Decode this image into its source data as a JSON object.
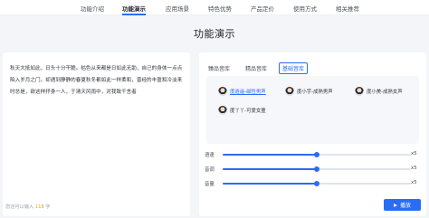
{
  "nav": {
    "items": [
      "功能介绍",
      "功能演示",
      "应用场景",
      "特色优势",
      "产品定价",
      "使用方式",
      "相关推荐"
    ],
    "active_index": 1
  },
  "section_title": "功能演示",
  "text_panel": {
    "content": "秋天大抵如此，日头十分干脆。枯色从来都是日如此无助，自己的身体一点点陷入岁月之门。却遇到静静的春夏秋冬都如此一样柔和，曾经的丰盈和冷淡来时总是，欲这样抒身一人，于清天风雨中，对我致千言者",
    "char_count_prefix": "您还可以输入",
    "char_count_value": "118",
    "char_count_suffix": "字"
  },
  "tabs": [
    "臻品音库",
    "精品音库",
    "基础音库"
  ],
  "active_tab": 2,
  "voices": [
    {
      "label": "度逍遥-磁性男声",
      "selected": true
    },
    {
      "label": "度小宇-成熟男声",
      "selected": false
    },
    {
      "label": "度小美-成熟女声",
      "selected": false
    },
    {
      "label": "度丫丫-可爱女童",
      "selected": false
    }
  ],
  "sliders": [
    {
      "label": "语速",
      "value": "x5",
      "fraction": 0.5
    },
    {
      "label": "音调",
      "value": "x5",
      "fraction": 0.5
    },
    {
      "label": "音量",
      "value": "x5",
      "fraction": 0.5
    }
  ],
  "play_button": {
    "label": "播放"
  },
  "colors": {
    "accent": "#2b6cf6",
    "count_highlight": "#f0a020"
  }
}
